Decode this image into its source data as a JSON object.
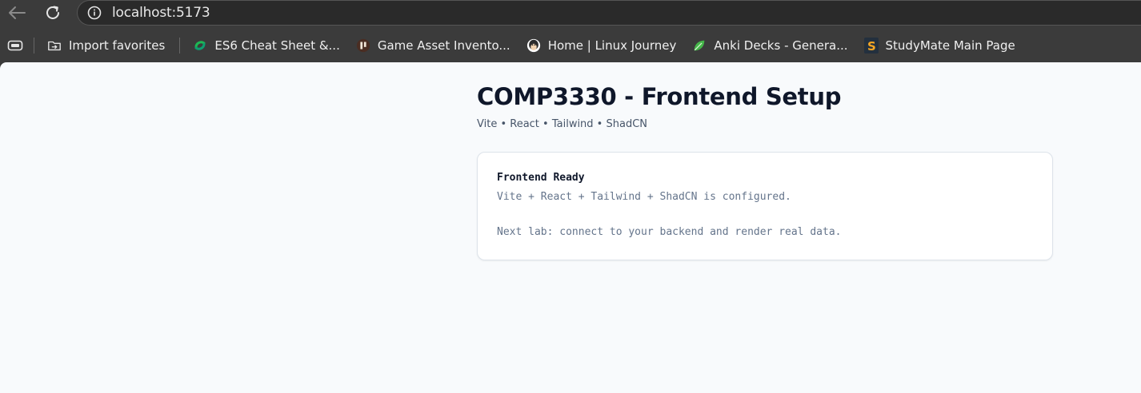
{
  "browser": {
    "url": "localhost:5173",
    "bookmarks": [
      {
        "label": "Import favorites",
        "icon": "import-favorites-icon"
      },
      {
        "label": "ES6 Cheat Sheet &...",
        "icon": "es6-site-icon"
      },
      {
        "label": "Game Asset Invento...",
        "icon": "game-asset-site-icon"
      },
      {
        "label": "Home | Linux Journey",
        "icon": "linux-journey-site-icon"
      },
      {
        "label": "Anki Decks - Genera...",
        "icon": "anki-site-icon"
      },
      {
        "label": "StudyMate Main Page",
        "icon": "studymate-site-icon"
      }
    ]
  },
  "page": {
    "title": "COMP3330 - Frontend Setup",
    "subtitle": "Vite • React • Tailwind • ShadCN",
    "card": {
      "title": "Frontend Ready",
      "line1": "Vite + React + Tailwind + ShadCN is configured.",
      "line2": "Next lab: connect to your backend and render real data."
    }
  },
  "colors": {
    "page_background": "#f8fafc",
    "heading": "#0f172a",
    "muted_text": "#64748b",
    "card_border": "#dde3ea",
    "browser_chrome": "#3b3b3b"
  }
}
